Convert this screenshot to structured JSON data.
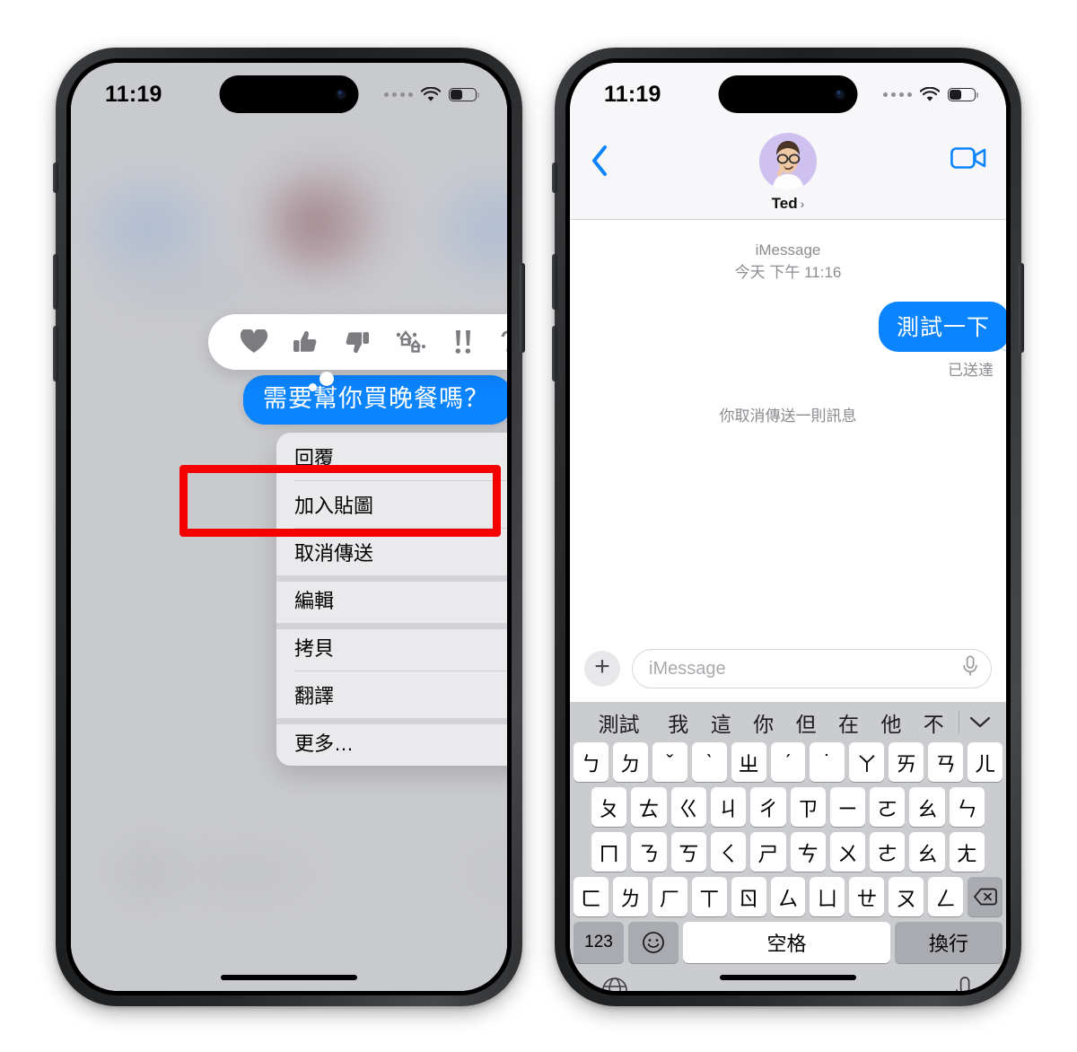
{
  "left_phone": {
    "status_bar": {
      "time": "11:19",
      "wifi_icon": "wifi-icon",
      "battery_icon": "battery-icon",
      "signal_icon": "cellular-dots-icon"
    },
    "reactions": [
      {
        "name": "heart-reaction",
        "glyph": "♥"
      },
      {
        "name": "thumbs-up-reaction",
        "glyph": "👍"
      },
      {
        "name": "thumbs-down-reaction",
        "glyph": "👎"
      },
      {
        "name": "haha-reaction",
        "glyph": "哈哈"
      },
      {
        "name": "exclamation-reaction",
        "glyph": "!!"
      },
      {
        "name": "question-reaction",
        "glyph": "?"
      }
    ],
    "bubble_text": "需要幫你買晚餐嗎？",
    "context_menu": [
      {
        "label": "回覆",
        "icon": "reply-icon"
      },
      {
        "label": "加入貼圖",
        "icon": "add-sticker-icon"
      },
      {
        "label": "取消傳送",
        "icon": "undo-send-icon"
      },
      {
        "label": "編輯",
        "icon": "pencil-icon"
      },
      {
        "label": "拷貝",
        "icon": "copy-icon"
      },
      {
        "label": "翻譯",
        "icon": "translate-icon"
      },
      {
        "label": "更多…",
        "icon": "more-ellipsis-icon"
      }
    ],
    "highlight": {
      "target_label": "取消傳送",
      "color": "#f40000"
    }
  },
  "right_phone": {
    "status_bar": {
      "time": "11:19",
      "wifi_icon": "wifi-icon",
      "battery_icon": "battery-icon",
      "signal_icon": "cellular-dots-icon"
    },
    "nav": {
      "back_icon": "back-chevron-icon",
      "contact_name": "Ted",
      "contact_chevron": "›",
      "facetime_icon": "facetime-video-icon"
    },
    "thread": {
      "service_label": "iMessage",
      "timestamp": "今天 下午 11:16",
      "sent_message": "測試一下",
      "delivery_status": "已送達",
      "system_note": "你取消傳送一則訊息"
    },
    "composer": {
      "plus_label": "+",
      "placeholder": "iMessage",
      "mic_icon": "microphone-icon"
    },
    "keyboard": {
      "candidates": [
        "測試",
        "我",
        "這",
        "你",
        "但",
        "在",
        "他",
        "不"
      ],
      "collapse_icon": "chevron-down-icon",
      "row1": [
        "ㄅ",
        "ㄉ",
        "ˇ",
        "ˋ",
        "ㄓ",
        "ˊ",
        "˙",
        "ㄚ",
        "ㄞ",
        "ㄢ",
        "ㄦ"
      ],
      "row2": [
        "ㄆ",
        "ㄊ",
        "ㄍ",
        "ㄐ",
        "ㄔ",
        "ㄗ",
        "ㄧ",
        "ㄛ",
        "ㄠ",
        "ㄣ"
      ],
      "row3": [
        "ㄇ",
        "ㄋ",
        "ㄎ",
        "ㄑ",
        "ㄕ",
        "ㄘ",
        "ㄨ",
        "ㄜ",
        "ㄠ",
        "ㄤ"
      ],
      "row4": [
        "ㄈ",
        "ㄌ",
        "ㄏ",
        "ㄒ",
        "ㄖ",
        "ㄙ",
        "ㄩ",
        "ㄝ",
        "ㄡ",
        "ㄥ"
      ],
      "delete_icon": "delete-backspace-icon",
      "numeric_key": "123",
      "emoji_key": "emoji-smiley-icon",
      "space_key": "空格",
      "return_key": "換行",
      "globe_icon": "globe-keyboard-icon",
      "dictation_icon": "microphone-icon"
    }
  }
}
